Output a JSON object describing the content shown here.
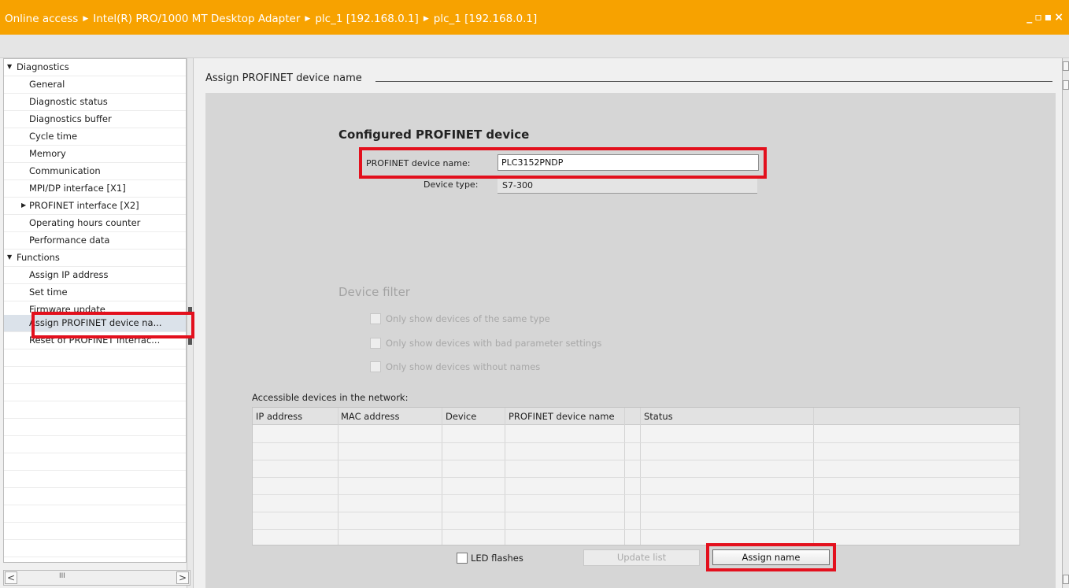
{
  "titlebar": {
    "crumbs": [
      "Online access",
      "Intel(R) PRO/1000 MT Desktop Adapter",
      "plc_1 [192.168.0.1]",
      "plc_1 [192.168.0.1]"
    ],
    "window_controls": "_ ▫ ▪ ×",
    "bg_color": "#f7a200"
  },
  "tree": {
    "items": [
      {
        "label": "Diagnostics",
        "level": 0,
        "expander": "expanded"
      },
      {
        "label": "General",
        "level": 1
      },
      {
        "label": "Diagnostic status",
        "level": 1
      },
      {
        "label": "Diagnostics buffer",
        "level": 1
      },
      {
        "label": "Cycle time",
        "level": 1
      },
      {
        "label": "Memory",
        "level": 1
      },
      {
        "label": "Communication",
        "level": 1
      },
      {
        "label": "MPI/DP interface [X1]",
        "level": 1
      },
      {
        "label": "PROFINET interface [X2]",
        "level": 1,
        "expander": "collapsed"
      },
      {
        "label": "Operating hours counter",
        "level": 1
      },
      {
        "label": "Performance data",
        "level": 1
      },
      {
        "label": "Functions",
        "level": 0,
        "expander": "expanded"
      },
      {
        "label": "Assign IP address",
        "level": 1
      },
      {
        "label": "Set time",
        "level": 1
      },
      {
        "label": "Firmware update",
        "level": 1
      },
      {
        "label": "Assign PROFINET device na...",
        "level": 1,
        "selected": true
      },
      {
        "label": "Reset of PROFINET interfac...",
        "level": 1
      }
    ],
    "scroll_left": "<",
    "scroll_thumb": "III",
    "scroll_right": ">"
  },
  "main": {
    "section_title": "Assign PROFINET device name",
    "configured": {
      "heading": "Configured PROFINET device",
      "name_label": "PROFINET device name:",
      "name_value": "PLC3152PNDP",
      "type_label": "Device type:",
      "type_value": "S7-300"
    },
    "filter": {
      "heading": "Device filter",
      "options": [
        {
          "label": "Only show devices of the same type",
          "checked": false
        },
        {
          "label": "Only show devices with bad parameter settings",
          "checked": false
        },
        {
          "label": "Only show devices without names",
          "checked": false
        }
      ]
    },
    "network": {
      "label": "Accessible devices in the network:",
      "columns": [
        "IP address",
        "MAC address",
        "Device",
        "PROFINET device name",
        "Status"
      ],
      "rows": []
    },
    "led_label": "LED flashes",
    "update_button": "Update list",
    "assign_button": "Assign name"
  },
  "highlight_color": "#e3101d"
}
